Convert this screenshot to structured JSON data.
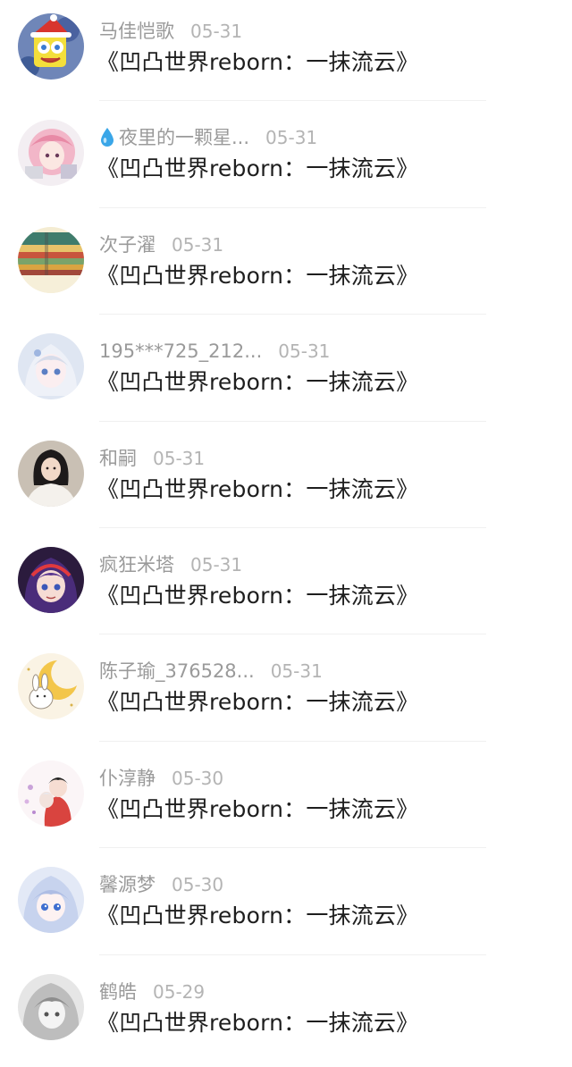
{
  "comments": [
    {
      "name": "马佳恺歌",
      "date": "05-31",
      "title": "《凹凸世界reborn：一抹流云》",
      "avatar": "spongebob-santa-avatar"
    },
    {
      "name": "夜里的一颗星...",
      "name_icon": "water-drop-icon",
      "date": "05-31",
      "title": "《凹凸世界reborn：一抹流云》",
      "avatar": "pink-hair-anime-avatar"
    },
    {
      "name": "次子濯",
      "date": "05-31",
      "title": "《凹凸世界reborn：一抹流云》",
      "avatar": "stacked-books-avatar"
    },
    {
      "name": "195***725_212...",
      "date": "05-31",
      "title": "《凹凸世界reborn：一抹流云》",
      "avatar": "white-hair-anime-avatar"
    },
    {
      "name": "和嗣",
      "date": "05-31",
      "title": "《凹凸世界reborn：一抹流云》",
      "avatar": "girl-photo-avatar"
    },
    {
      "name": "疯狂米塔",
      "date": "05-31",
      "title": "《凹凸世界reborn：一抹流云》",
      "avatar": "purple-hair-anime-avatar"
    },
    {
      "name": "陈子瑜_376528...",
      "date": "05-31",
      "title": "《凹凸世界reborn：一抹流云》",
      "avatar": "bunny-moon-avatar"
    },
    {
      "name": "仆淳静",
      "date": "05-30",
      "title": "《凹凸世界reborn：一抹流云》",
      "avatar": "anime-couple-avatar"
    },
    {
      "name": "馨源梦",
      "date": "05-30",
      "title": "《凹凸世界reborn：一抹流云》",
      "avatar": "blue-hair-anime-avatar"
    },
    {
      "name": "鹤皓",
      "date": "05-29",
      "title": "《凹凸世界reborn：一抹流云》",
      "avatar": "grayscale-anime-avatar"
    }
  ]
}
